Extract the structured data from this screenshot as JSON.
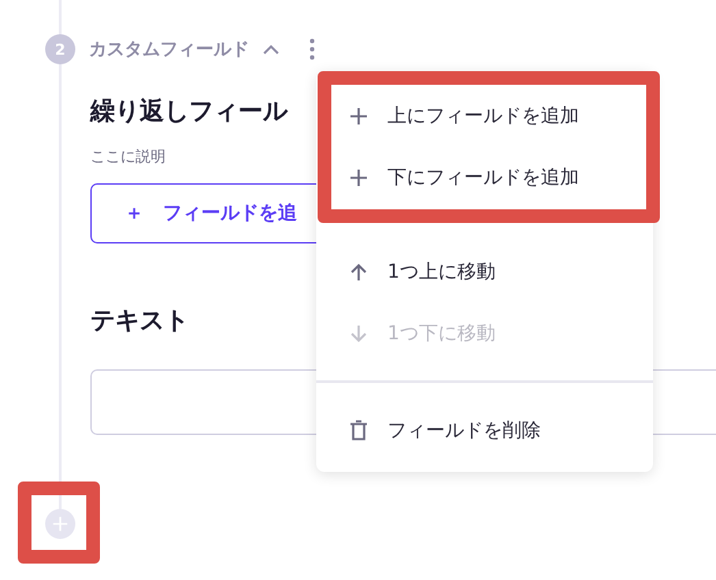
{
  "step": {
    "number": "2",
    "title": "カスタムフィールド",
    "expanded": true
  },
  "repeat_field": {
    "heading": "繰り返しフィール",
    "description": "ここに説明",
    "add_button": {
      "icon": "＋",
      "label": "フィールドを追"
    }
  },
  "text_field": {
    "heading": "テキスト"
  },
  "add_step_button": {
    "highlighted": true
  },
  "menu": {
    "highlighted_group": true,
    "items": [
      {
        "kind": "add",
        "label": "上にフィールドを追加",
        "disabled": false
      },
      {
        "kind": "add",
        "label": "下にフィールドを追加",
        "disabled": false
      },
      {
        "kind": "up",
        "label": "1つ上に移動",
        "disabled": false
      },
      {
        "kind": "down",
        "label": "1つ下に移動",
        "disabled": true
      },
      {
        "kind": "delete",
        "label": "フィールドを削除",
        "disabled": false
      }
    ]
  }
}
